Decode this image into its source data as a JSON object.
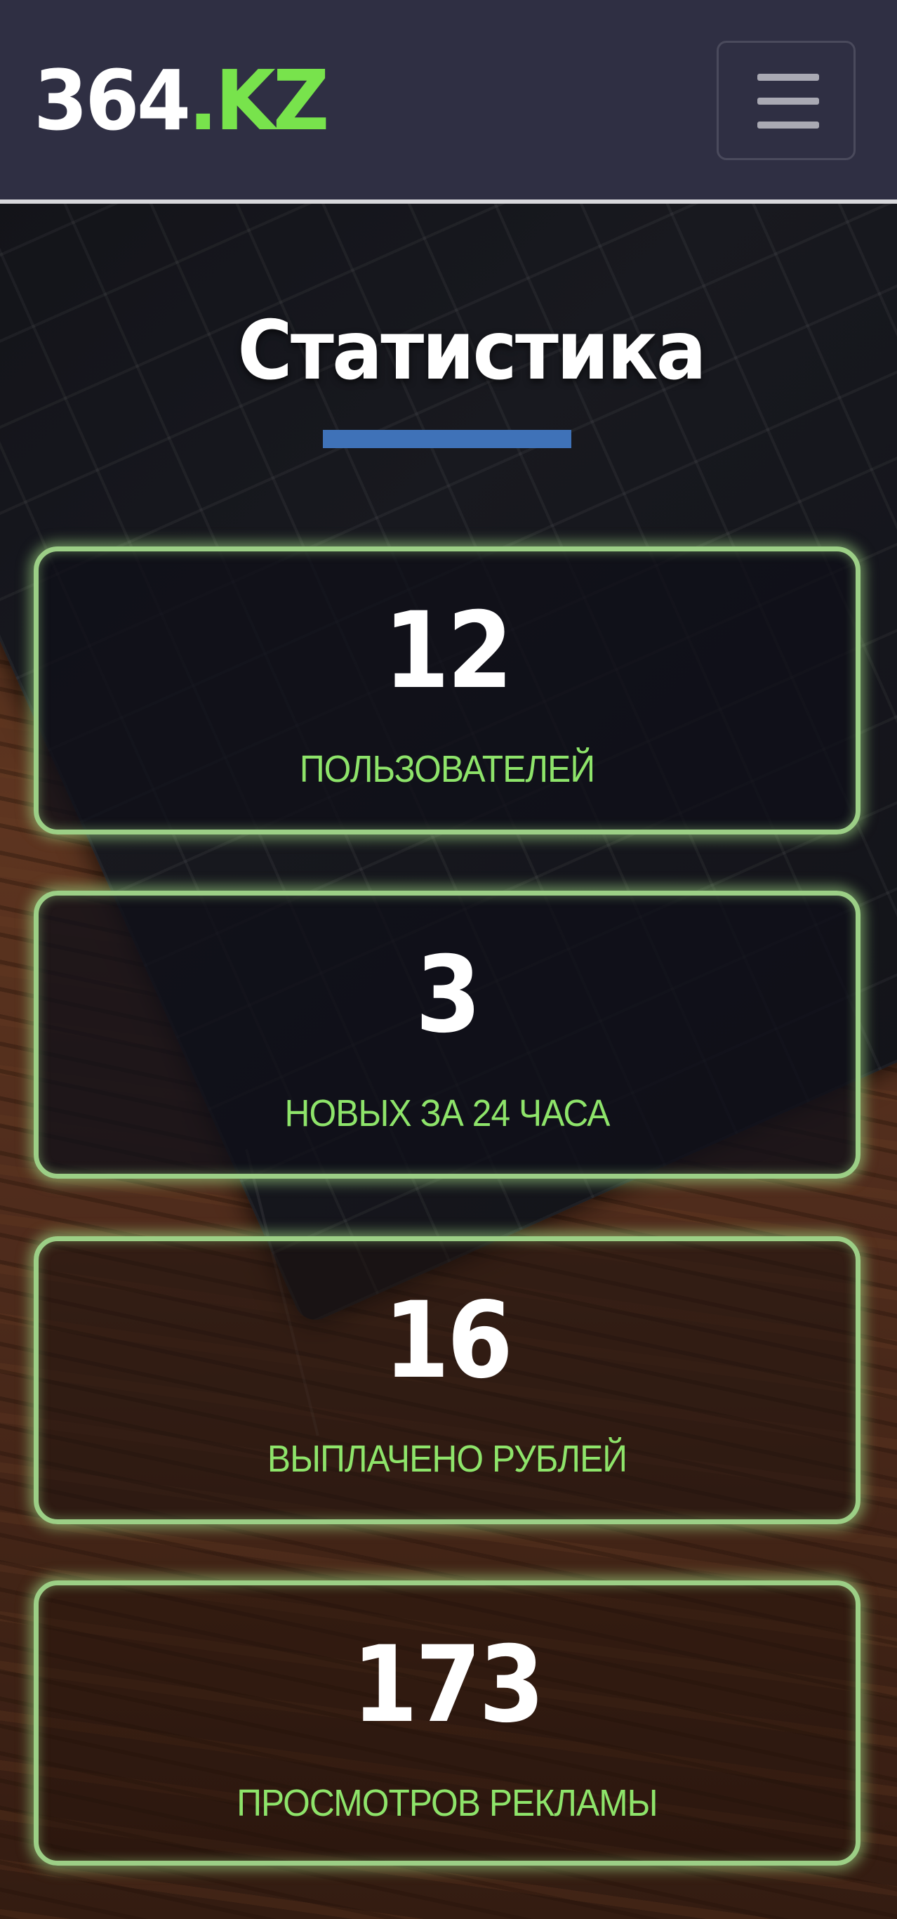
{
  "header": {
    "logo_main": "364",
    "logo_accent": ".KZ",
    "menu_icon": "hamburger-icon"
  },
  "section": {
    "title": "Статистика"
  },
  "stats": [
    {
      "value": "12",
      "label": "ПОЛЬЗОВАТЕЛЕЙ"
    },
    {
      "value": "3",
      "label": "НОВЫХ ЗА 24 ЧАСА"
    },
    {
      "value": "16",
      "label": "ВЫПЛАЧЕНО РУБЛЕЙ"
    },
    {
      "value": "173",
      "label": "ПРОСМОТРОВ РЕКЛАМЫ"
    }
  ],
  "colors": {
    "header_bg": "#2f2f43",
    "logo_accent": "#78e34c",
    "card_border": "#9ccf86",
    "label": "#8ee46a",
    "title_underline": "#3f72b8"
  }
}
